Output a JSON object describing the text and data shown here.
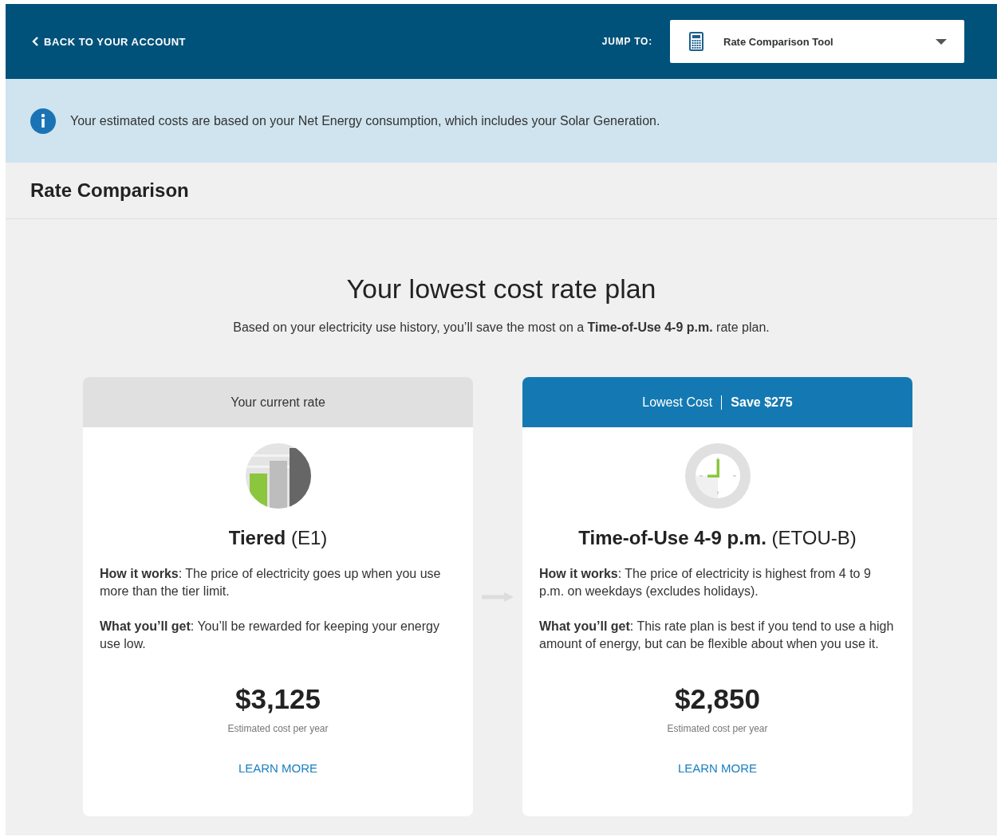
{
  "header": {
    "back_link": "BACK TO YOUR ACCOUNT",
    "jump_label": "JUMP TO:",
    "jump_select": {
      "value": "Rate Comparison Tool"
    }
  },
  "notice": {
    "text": "Your estimated costs are based on your Net Energy consumption, which includes your Solar Generation."
  },
  "page_title": "Rate Comparison",
  "hero": {
    "title": "Your lowest cost rate plan",
    "subtitle": "Based on your electricity use history, you’ll save the most on a **Time-of-Use 4-9 p.m.** rate plan."
  },
  "cards": [
    {
      "kind": "current",
      "header": {
        "label": "Your current rate"
      },
      "plan": "**Tiered** (E1)",
      "how_it_works": "**How it works**: The price of electricity goes up when you use more than the tier limit.",
      "what_you_get": "**What you’ll get**: You’ll be rewarded for keeping your energy use low.",
      "cost": "$3,125",
      "cost_label": "Estimated cost per year",
      "link": "LEARN MORE"
    },
    {
      "kind": "recommended",
      "header": {
        "label": "Lowest Cost",
        "savings": "Save $275"
      },
      "plan": "**Time-of-Use 4-9 p.m.** (ETOU-B)",
      "how_it_works": "**How it works**: The price of electricity is highest from 4 to 9 p.m. on weekdays (excludes holidays).",
      "what_you_get": "**What you’ll get**: This rate plan is best if you tend to use a high amount of energy, but can be flexible about when you use it.",
      "cost": "$2,850",
      "cost_label": "Estimated cost per year",
      "link": "LEARN MORE"
    }
  ]
}
